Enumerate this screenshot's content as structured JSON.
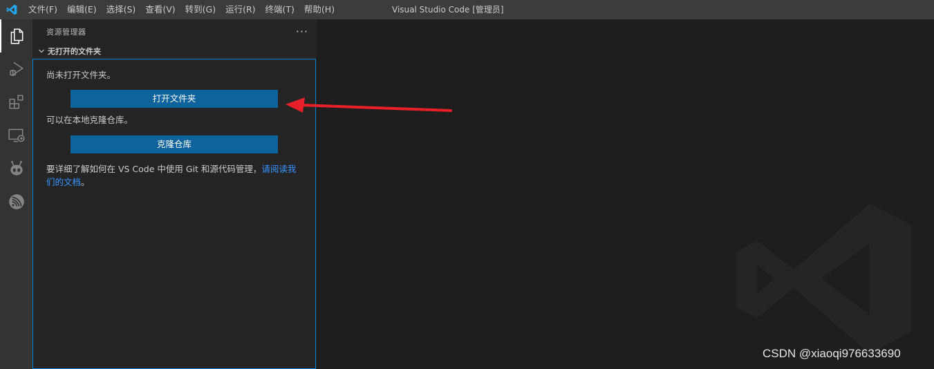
{
  "titlebar": {
    "app_icon": "vscode-logo-icon",
    "menu": [
      "文件(F)",
      "编辑(E)",
      "选择(S)",
      "查看(V)",
      "转到(G)",
      "运行(R)",
      "终端(T)",
      "帮助(H)"
    ],
    "window_title": "Visual Studio Code [管理员]"
  },
  "activitybar": {
    "items": [
      {
        "icon": "explorer-files-icon",
        "active": true
      },
      {
        "icon": "run-debug-icon"
      },
      {
        "icon": "extensions-icon"
      },
      {
        "icon": "remote-explorer-icon"
      },
      {
        "icon": "platformio-alien-icon"
      },
      {
        "icon": "espressif-icon"
      }
    ]
  },
  "sidebar": {
    "title": "资源管理器",
    "more_actions": "···",
    "section_title": "无打开的文件夹",
    "no_folder_msg": "尚未打开文件夹。",
    "open_folder_button": "打开文件夹",
    "clone_msg": "可以在本地克隆仓库。",
    "clone_button": "克隆仓库",
    "learn_more_prefix": "要详细了解如何在 VS Code 中使用 Git 和源代码管理，",
    "learn_more_link": "请阅读我们的文档",
    "learn_more_suffix": "。"
  },
  "watermark": {
    "text": "CSDN @xiaoqi976633690"
  },
  "colors": {
    "titlebar": "#3c3c3c",
    "activitybar": "#333333",
    "sidebar": "#252526",
    "editor": "#1e1e1e",
    "button": "#0e639c",
    "focus_border": "#007fd4",
    "link": "#3794ff",
    "annotation_arrow": "#e8202a"
  }
}
